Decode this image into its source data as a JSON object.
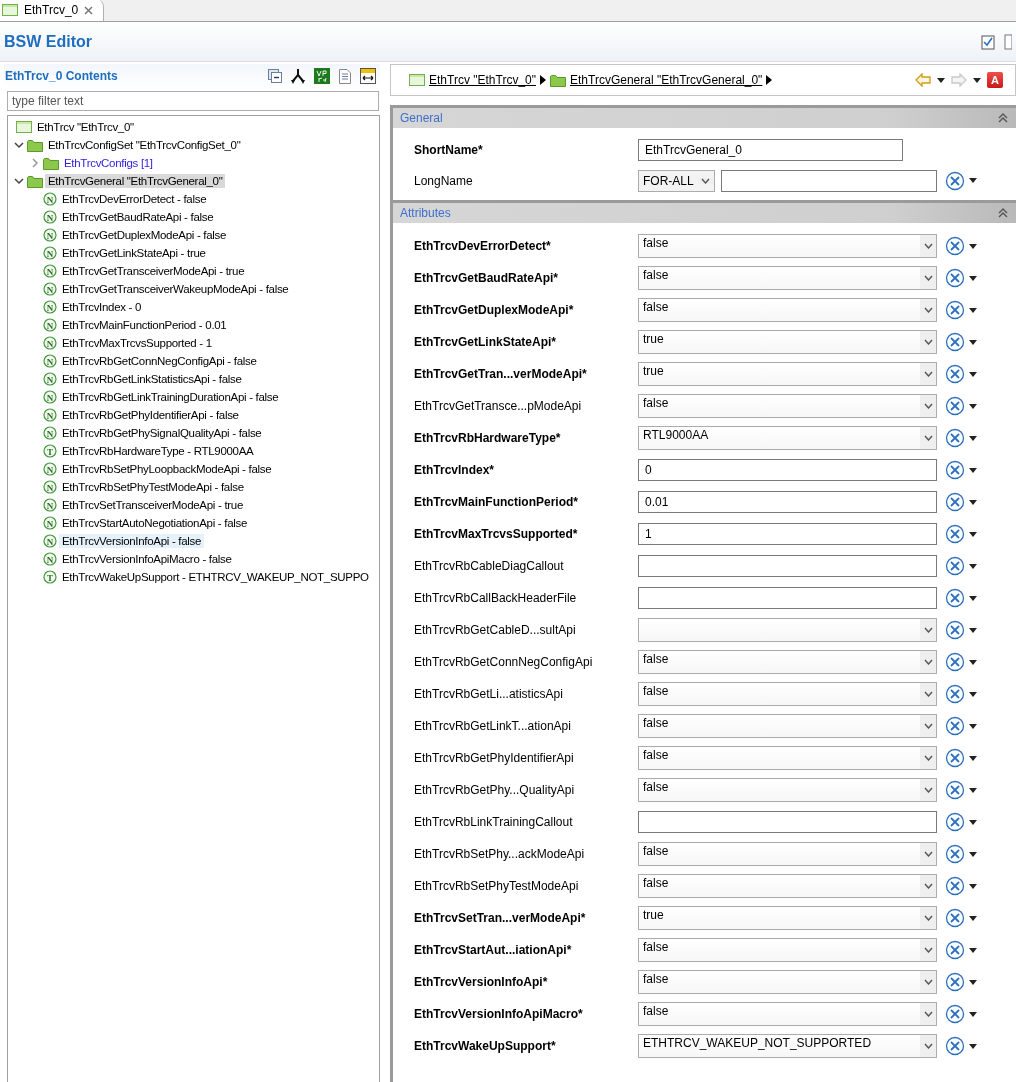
{
  "editor_tab": {
    "label": "EthTrcv_0",
    "selected": true
  },
  "editor": {
    "title": "BSW Editor"
  },
  "contents": {
    "title": "EthTrcv_0 Contents",
    "filter": {
      "placeholder": "type filter text"
    },
    "tree": [
      {
        "kind": "module",
        "label": "EthTrcv \"EthTrcv_0\"",
        "selected": false,
        "hovered": false
      },
      {
        "kind": "container",
        "label": "EthTrcvConfigSet \"EthTrcvConfigSet_0\"",
        "expanded": true,
        "selected": false,
        "hovered": false,
        "children": [
          {
            "kind": "list",
            "label": "EthTrcvConfigs [1]",
            "expanded": false,
            "selected": false,
            "hovered": false
          }
        ]
      },
      {
        "kind": "container",
        "label": "EthTrcvGeneral \"EthTrcvGeneral_0\"",
        "expanded": true,
        "selected": true,
        "hovered": false,
        "children": [
          {
            "kind": "param",
            "badge": "N",
            "label": "EthTrcvDevErrorDetect - false",
            "selected": false,
            "hovered": false
          },
          {
            "kind": "param",
            "badge": "N",
            "label": "EthTrcvGetBaudRateApi - false",
            "selected": false,
            "hovered": false
          },
          {
            "kind": "param",
            "badge": "N",
            "label": "EthTrcvGetDuplexModeApi - false",
            "selected": false,
            "hovered": false
          },
          {
            "kind": "param",
            "badge": "N",
            "label": "EthTrcvGetLinkStateApi - true",
            "selected": false,
            "hovered": false
          },
          {
            "kind": "param",
            "badge": "N",
            "label": "EthTrcvGetTransceiverModeApi - true",
            "selected": false,
            "hovered": false
          },
          {
            "kind": "param",
            "badge": "N",
            "label": "EthTrcvGetTransceiverWakeupModeApi - false",
            "selected": false,
            "hovered": false
          },
          {
            "kind": "param",
            "badge": "N",
            "label": "EthTrcvIndex - 0",
            "selected": false,
            "hovered": false
          },
          {
            "kind": "param",
            "badge": "N",
            "label": "EthTrcvMainFunctionPeriod - 0.01",
            "selected": false,
            "hovered": false
          },
          {
            "kind": "param",
            "badge": "N",
            "label": "EthTrcvMaxTrcvsSupported - 1",
            "selected": false,
            "hovered": false
          },
          {
            "kind": "param",
            "badge": "N",
            "label": "EthTrcvRbGetConnNegConfigApi - false",
            "selected": false,
            "hovered": false
          },
          {
            "kind": "param",
            "badge": "N",
            "label": "EthTrcvRbGetLinkStatisticsApi - false",
            "selected": false,
            "hovered": false
          },
          {
            "kind": "param",
            "badge": "N",
            "label": "EthTrcvRbGetLinkTrainingDurationApi - false",
            "selected": false,
            "hovered": false
          },
          {
            "kind": "param",
            "badge": "N",
            "label": "EthTrcvRbGetPhyIdentifierApi - false",
            "selected": false,
            "hovered": false
          },
          {
            "kind": "param",
            "badge": "N",
            "label": "EthTrcvRbGetPhySignalQualityApi - false",
            "selected": false,
            "hovered": false
          },
          {
            "kind": "param",
            "badge": "T",
            "label": "EthTrcvRbHardwareType - RTL9000AA",
            "selected": false,
            "hovered": false
          },
          {
            "kind": "param",
            "badge": "N",
            "label": "EthTrcvRbSetPhyLoopbackModeApi - false",
            "selected": false,
            "hovered": false
          },
          {
            "kind": "param",
            "badge": "N",
            "label": "EthTrcvRbSetPhyTestModeApi - false",
            "selected": false,
            "hovered": false
          },
          {
            "kind": "param",
            "badge": "N",
            "label": "EthTrcvSetTransceiverModeApi - true",
            "selected": false,
            "hovered": false
          },
          {
            "kind": "param",
            "badge": "N",
            "label": "EthTrcvStartAutoNegotiationApi - false",
            "selected": false,
            "hovered": false
          },
          {
            "kind": "param",
            "badge": "N",
            "label": "EthTrcvVersionInfoApi - false",
            "selected": false,
            "hovered": true
          },
          {
            "kind": "param",
            "badge": "N",
            "label": "EthTrcvVersionInfoApiMacro - false",
            "selected": false,
            "hovered": false
          },
          {
            "kind": "param",
            "badge": "T",
            "label": "EthTrcvWakeUpSupport - ETHTRCV_WAKEUP_NOT_SUPPO",
            "selected": false,
            "hovered": false
          }
        ]
      }
    ]
  },
  "breadcrumb": [
    {
      "kind": "module",
      "label": "EthTrcv \"EthTrcv_0\""
    },
    {
      "kind": "container",
      "label": "EthTrcvGeneral \"EthTrcvGeneral_0\""
    }
  ],
  "navigation": {
    "back": {
      "disabled": false
    },
    "forward": {
      "disabled": true
    },
    "validation": {
      "label": "A"
    }
  },
  "sections": [
    {
      "title": "General",
      "expanded": true,
      "fields": [
        {
          "kind": "name",
          "label": "ShortName*",
          "required": true,
          "value": "EthTrcvGeneral_0"
        },
        {
          "kind": "multilang",
          "label": "LongName",
          "required": false,
          "language": "FOR-ALL"
        }
      ]
    },
    {
      "title": "Attributes",
      "expanded": true,
      "fields": [
        {
          "kind": "combo",
          "label": "EthTrcvDevErrorDetect*",
          "required": true,
          "value": "false"
        },
        {
          "kind": "combo",
          "label": "EthTrcvGetBaudRateApi*",
          "required": true,
          "value": "false"
        },
        {
          "kind": "combo",
          "label": "EthTrcvGetDuplexModeApi*",
          "required": true,
          "value": "false"
        },
        {
          "kind": "combo",
          "label": "EthTrcvGetLinkStateApi*",
          "required": true,
          "value": "true"
        },
        {
          "kind": "combo",
          "label": "EthTrcvGetTran...verModeApi*",
          "required": true,
          "value": "true"
        },
        {
          "kind": "combo",
          "label": "EthTrcvGetTransce...pModeApi",
          "required": false,
          "value": "false"
        },
        {
          "kind": "combo",
          "label": "EthTrcvRbHardwareType*",
          "required": true,
          "value": "RTL9000AA"
        },
        {
          "kind": "text",
          "label": "EthTrcvIndex*",
          "required": true,
          "value": "0"
        },
        {
          "kind": "text",
          "label": "EthTrcvMainFunctionPeriod*",
          "required": true,
          "value": "0.01"
        },
        {
          "kind": "text",
          "label": "EthTrcvMaxTrcvsSupported*",
          "required": true,
          "value": "1"
        },
        {
          "kind": "text",
          "label": "EthTrcvRbCableDiagCallout",
          "required": false
        },
        {
          "kind": "text",
          "label": "EthTrcvRbCallBackHeaderFile",
          "required": false
        },
        {
          "kind": "combo",
          "label": "EthTrcvRbGetCableD...sultApi",
          "required": false
        },
        {
          "kind": "combo",
          "label": "EthTrcvRbGetConnNegConfigApi",
          "required": false,
          "value": "false"
        },
        {
          "kind": "combo",
          "label": "EthTrcvRbGetLi...atisticsApi",
          "required": false,
          "value": "false"
        },
        {
          "kind": "combo",
          "label": "EthTrcvRbGetLinkT...ationApi",
          "required": false,
          "value": "false"
        },
        {
          "kind": "combo",
          "label": "EthTrcvRbGetPhyIdentifierApi",
          "required": false,
          "value": "false"
        },
        {
          "kind": "combo",
          "label": "EthTrcvRbGetPhy...QualityApi",
          "required": false,
          "value": "false"
        },
        {
          "kind": "text",
          "label": "EthTrcvRbLinkTrainingCallout",
          "required": false
        },
        {
          "kind": "combo",
          "label": "EthTrcvRbSetPhy...ackModeApi",
          "required": false,
          "value": "false"
        },
        {
          "kind": "combo",
          "label": "EthTrcvRbSetPhyTestModeApi",
          "required": false,
          "value": "false"
        },
        {
          "kind": "combo",
          "label": "EthTrcvSetTran...verModeApi*",
          "required": true,
          "value": "true"
        },
        {
          "kind": "combo",
          "label": "EthTrcvStartAut...iationApi*",
          "required": true,
          "value": "false"
        },
        {
          "kind": "combo",
          "label": "EthTrcvVersionInfoApi*",
          "required": true,
          "value": "false"
        },
        {
          "kind": "combo",
          "label": "EthTrcvVersionInfoApiMacro*",
          "required": true,
          "value": "false"
        },
        {
          "kind": "combo",
          "label": "EthTrcvWakeUpSupport*",
          "required": true,
          "value": "ETHTRCV_WAKEUP_NOT_SUPPORTED"
        }
      ]
    }
  ]
}
